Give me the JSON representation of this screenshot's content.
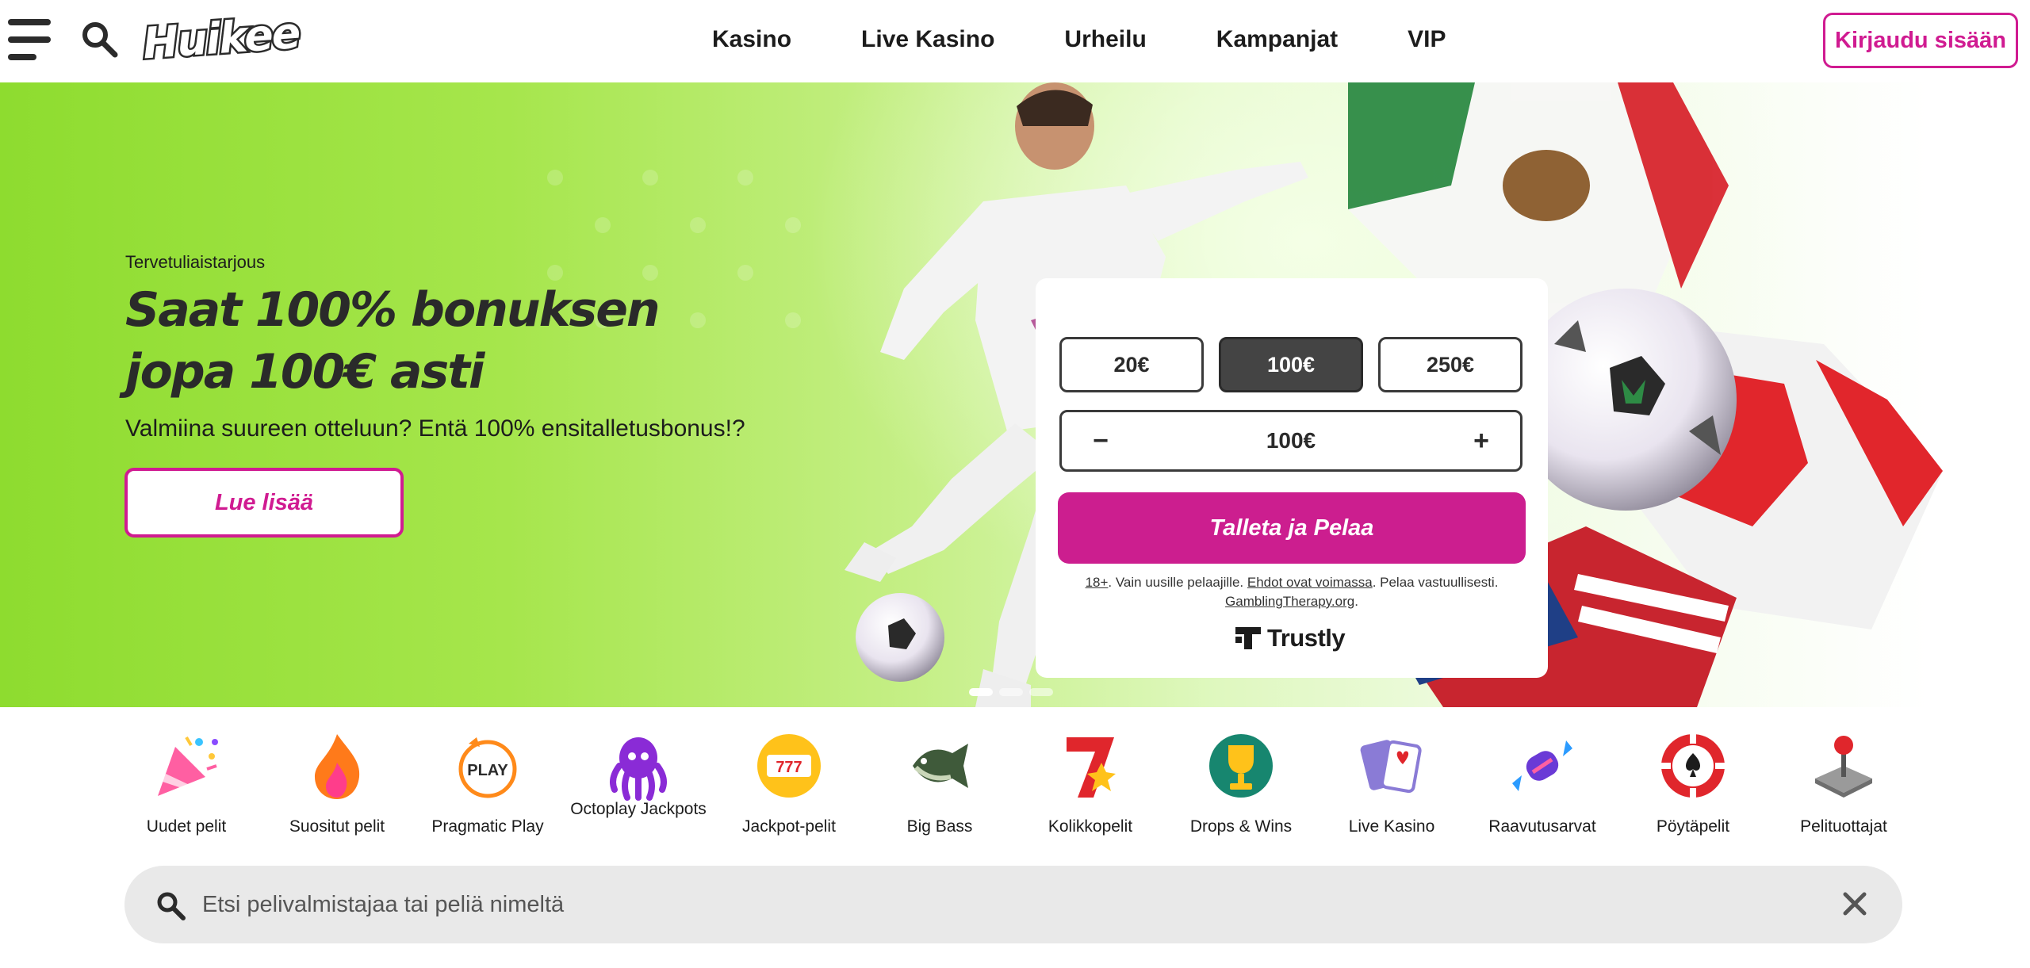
{
  "header": {
    "logo": "Huikee",
    "nav": [
      "Kasino",
      "Live Kasino",
      "Urheilu",
      "Kampanjat",
      "VIP"
    ],
    "login_label": "Kirjaudu sisään"
  },
  "hero": {
    "eyebrow": "Tervetuliaistarjous",
    "title": "Saat 100% bonuksen jopa 100€ asti",
    "subtitle": "Valmiina suureen otteluun? Entä 100% ensitalletusbonus!?",
    "cta_label": "Lue lisää",
    "slides_total": 3,
    "slide_active": 1
  },
  "deposit": {
    "amounts": [
      "20€",
      "100€",
      "250€"
    ],
    "selected_amount": "100€",
    "stepper_value": "100€",
    "minus": "−",
    "plus": "+",
    "submit_label": "Talleta ja Pelaa",
    "terms": {
      "age": "18+",
      "text1": ". Vain uusille pelaajille. ",
      "link1": "Ehdot ovat voimassa",
      "text2": ". Pelaa vastuullisesti.",
      "link2": "GamblingTherapy.org",
      "text3": "."
    },
    "provider": "Trustly"
  },
  "categories": [
    {
      "label": "Uudet pelit",
      "icon": "party-popper-icon"
    },
    {
      "label": "Suositut pelit",
      "icon": "flame-icon"
    },
    {
      "label": "Pragmatic Play",
      "icon": "pragmatic-play-icon"
    },
    {
      "label": "Octoplay Jackpots",
      "icon": "octopus-icon"
    },
    {
      "label": "Jackpot-pelit",
      "icon": "slot-777-icon"
    },
    {
      "label": "Big Bass",
      "icon": "fish-icon"
    },
    {
      "label": "Kolikkopelit",
      "icon": "lucky-seven-icon"
    },
    {
      "label": "Drops & Wins",
      "icon": "trophy-icon"
    },
    {
      "label": "Live Kasino",
      "icon": "cards-icon"
    },
    {
      "label": "Raavutusarvat",
      "icon": "candy-icon"
    },
    {
      "label": "Pöytäpelit",
      "icon": "poker-chip-icon"
    },
    {
      "label": "Pelituottajat",
      "icon": "joystick-icon"
    }
  ],
  "search": {
    "placeholder": "Etsi pelivalmistajaa tai peliä nimeltä"
  },
  "colors": {
    "brand": "#cc1e8f",
    "hero_green": "#8edc2f",
    "dark": "#2b2b2b"
  }
}
